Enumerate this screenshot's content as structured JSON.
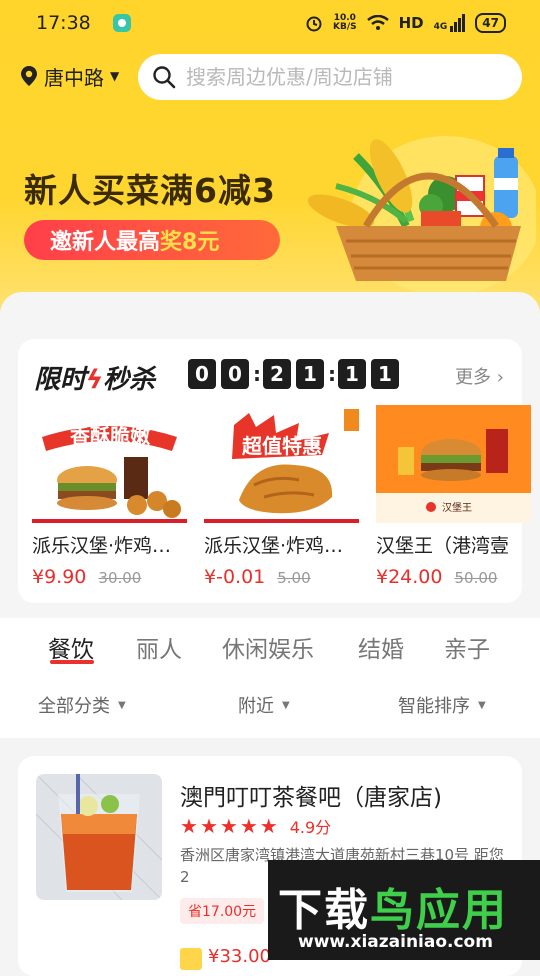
{
  "status": {
    "time": "17:38",
    "speed_top": "10.0",
    "speed_bottom": "KB/S",
    "network": "HD",
    "signal": "4G",
    "battery": "47"
  },
  "header": {
    "location": "唐中路",
    "search_placeholder": "搜索周边优惠/周边店铺"
  },
  "banner": {
    "title": "新人买菜满6减3",
    "sub_prefix": "邀新人最高",
    "sub_highlight": "奖8元"
  },
  "flash_sale": {
    "title_a": "限时",
    "title_b": "秒杀",
    "countdown": [
      "0",
      "0",
      "2",
      "1",
      "1",
      "1"
    ],
    "more": "更多",
    "deals": [
      {
        "name": "派乐汉堡·炸鸡…",
        "price": "¥9.90",
        "old_price": "30.00",
        "badge": "香酥脆嫩"
      },
      {
        "name": "派乐汉堡·炸鸡…",
        "price": "¥-0.01",
        "old_price": "5.00",
        "badge": "超值特惠"
      },
      {
        "name": "汉堡王（港湾壹",
        "price": "¥24.00",
        "old_price": "50.00",
        "badge": "汉堡王"
      }
    ]
  },
  "tabs": [
    "餐饮",
    "丽人",
    "休闲娱乐",
    "结婚",
    "亲子"
  ],
  "filters": [
    "全部分类",
    "附近",
    "智能排序"
  ],
  "store": {
    "name": "澳門叮叮茶餐吧（唐家店)",
    "score": "4.9分",
    "address": "香洲区唐家湾镇港湾大道唐苑新村三巷10号  距您2",
    "saving": "省17.00元",
    "price": "¥33.00"
  },
  "watermark": {
    "title_a": "下载",
    "title_b": "鸟应用",
    "url": "www.xiazainiao.com"
  },
  "colors": {
    "accent_red": "#e9322d",
    "brand_yellow": "#ffd52c"
  }
}
